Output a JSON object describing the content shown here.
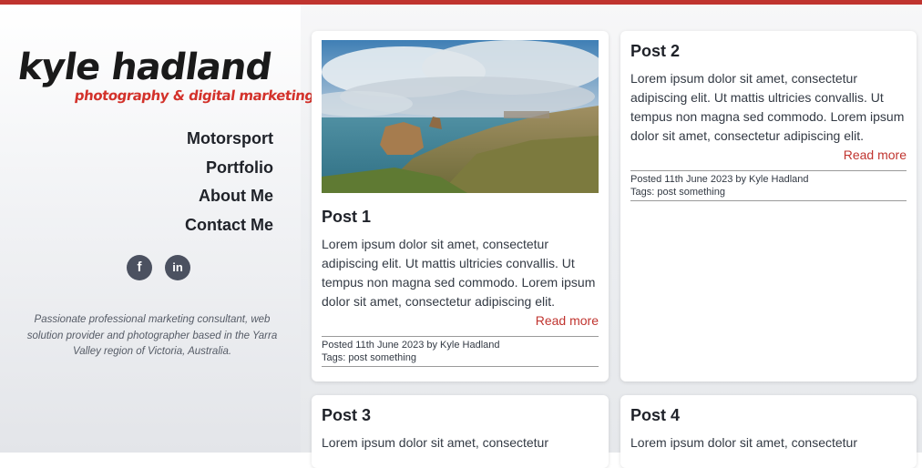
{
  "logo": {
    "name": "kyle hadland",
    "tagline": "photography & digital marketing"
  },
  "nav": {
    "items": [
      "Motorsport",
      "Portfolio",
      "About Me",
      "Contact Me"
    ]
  },
  "social": {
    "facebook": "f",
    "linkedin": "in",
    "icons": [
      "facebook-icon",
      "linkedin-icon"
    ]
  },
  "bio": "Passionate professional marketing consultant, web solution provider and photographer based in the Yarra Valley region of Victoria, Australia.",
  "colors": {
    "accent": "#c0342f",
    "icon_bg": "#4b5160"
  },
  "posts": [
    {
      "title": "Post 1",
      "excerpt": "Lorem ipsum dolor sit amet, consectetur adipiscing elit. Ut mattis ultricies convallis. Ut tempus non magna sed commodo. Lorem ipsum dolor sit amet, consectetur adipiscing elit.",
      "read_more": "Read more",
      "posted": "Posted 11th June 2023 by Kyle Hadland",
      "tags_label": "Tags:",
      "tag": "post something"
    },
    {
      "title": "Post 2",
      "excerpt": "Lorem ipsum dolor sit amet, consectetur adipiscing elit. Ut mattis ultricies convallis. Ut tempus non magna sed commodo. Lorem ipsum dolor sit amet, consectetur adipiscing elit.",
      "read_more": "Read more",
      "posted": "Posted 11th June 2023 by Kyle Hadland",
      "tags_label": "Tags:",
      "tag": "post something"
    },
    {
      "title": "Post 3",
      "excerpt": "Lorem ipsum dolor sit amet, consectetur"
    },
    {
      "title": "Post 4",
      "excerpt": "Lorem ipsum dolor sit amet, consectetur"
    }
  ]
}
